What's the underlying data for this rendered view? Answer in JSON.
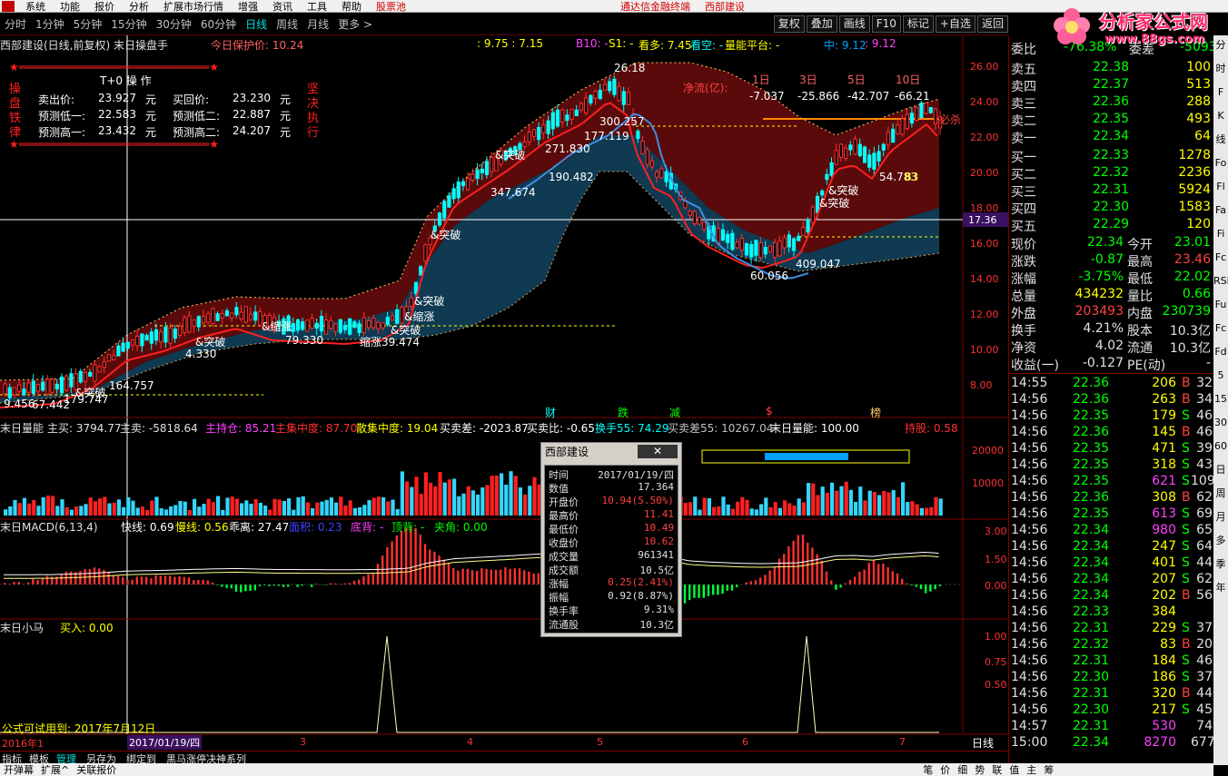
{
  "menubar": {
    "items": [
      "系统",
      "功能",
      "报价",
      "分析",
      "扩展市场行情",
      "资讯",
      "工具",
      "帮助"
    ],
    "extra_items": [
      "增强"
    ],
    "stock_link": "股票池",
    "window_title": "通达信金融终端",
    "stock_title": "西部建设"
  },
  "periodbar": {
    "periods": [
      "分时",
      "1分钟",
      "5分钟",
      "15分钟",
      "30分钟",
      "60分钟",
      "日线",
      "周线",
      "月线",
      "更多 >"
    ],
    "active": "日线",
    "tools": [
      "复权",
      "叠加",
      "画线",
      "F10",
      "标记",
      "+自选",
      "返回"
    ]
  },
  "logo": {
    "line1": "分析家公式网",
    "line2": "www.88gs.com"
  },
  "main_chart": {
    "header_title": "西部建设(日线,前复权) 末日操盘手",
    "protect_price": "今日保护价: 10.24",
    "range_text": ": 9.75 : 7.15",
    "b10": "B10: -",
    "s1": "S1: -",
    "look_up": "看多: 7.45",
    "look_empty": "看空: -",
    "energy": "量能平台: -",
    "mid": "中: 9.12",
    "mid2": ": 9.12",
    "y_ticks": [
      "26.00",
      "24.00",
      "22.00",
      "20.00",
      "18.00",
      "16.00",
      "14.00",
      "12.00",
      "10.00",
      "8.00"
    ],
    "cursor_price": "17.36",
    "t0_title": "T+0 操 作",
    "t0_side_left": [
      "操",
      "盘",
      "铁",
      "律"
    ],
    "t0_side_right": [
      "坚",
      "决",
      "执",
      "行"
    ],
    "t0_rows": [
      {
        "l1": "卖出价:",
        "v1": "23.927",
        "u1": "元",
        "l2": "买回价:",
        "v2": "23.230",
        "u2": "元"
      },
      {
        "l1": "预测低一:",
        "v1": "22.583",
        "u1": "元",
        "l2": "预测低二:",
        "v2": "22.887",
        "u2": "元"
      },
      {
        "l1": "预测高一:",
        "v1": "23.432",
        "u1": "元",
        "l2": "预测高二:",
        "v2": "24.207",
        "u2": "元"
      }
    ],
    "flow_title": "净流(亿):",
    "flow_headers": [
      "1日",
      "3日",
      "5日",
      "10日"
    ],
    "flow_values": [
      "-7.037",
      "-25.866",
      "-42.707",
      "-66.21"
    ],
    "must_kill": "必杀",
    "annotations": [
      "&突破",
      "&突破",
      "&突破",
      "&突破",
      "&突破",
      "&突破",
      "&突破",
      "&突破",
      "&缩涨",
      "缩涨",
      "&缩涨"
    ],
    "labels_num": [
      "26.18",
      "300.257",
      "271.830",
      "177.119",
      "190.482",
      "347.674",
      "164.757",
      "179.747",
      "67.442",
      "9.456",
      "4.330",
      "79.330",
      "39.474",
      "60.056",
      "409.047",
      "54.783",
      "83"
    ],
    "bottom_markers": [
      "财",
      "跌",
      "减",
      "$",
      "榜"
    ]
  },
  "volume_panel": {
    "title": "末日量能",
    "main_buy": "主买: 3794.77",
    "main_sell": "主卖: -5818.64",
    "main_hold": "主持仓: 85.21",
    "main_conc": "主集中度: 87.70",
    "retail_conc": "散集中度: 19.04",
    "diff": "买卖差: -2023.87",
    "ratio": "买卖比: -0.65",
    "turnover": "换手55: 74.29",
    "diff55": "买卖差55: 10267.04",
    "energy": "末日量能: 100.00",
    "hold": "持股: 0.58",
    "y_ticks": [
      "20000",
      "10000"
    ]
  },
  "macd_panel": {
    "title": "末日MACD(6,13,4)",
    "fast": "快线: 0.69",
    "slow": "慢线: 0.56",
    "dev": "乖离: 27.47",
    "area": "面积: 0.23",
    "bottom": "底背: -",
    "top": "顶背: -",
    "angle": "夹角: 0.00",
    "y_ticks": [
      "3.00",
      "1.50",
      "0.00"
    ]
  },
  "horse_panel": {
    "title": "末日小马",
    "buy": "买入: 0.00",
    "trial": "公式可试用到: 2017年7月12日",
    "y_ticks": [
      "1.00",
      "0.75",
      "0.50"
    ]
  },
  "x_axis": {
    "labels": [
      "2016年1",
      "2017/01/19/四",
      "3",
      "4",
      "5",
      "6",
      "7"
    ],
    "period": "日线"
  },
  "popup": {
    "title": "西部建设",
    "close": "✕",
    "rows": [
      {
        "label": "时间",
        "value": "2017/01/19/四",
        "red": false
      },
      {
        "label": "数值",
        "value": "17.364",
        "red": false
      },
      {
        "label": "开盘价",
        "value": "10.94(5.50%)",
        "red": true
      },
      {
        "label": "最高价",
        "value": "11.41",
        "red": true
      },
      {
        "label": "最低价",
        "value": "10.49",
        "red": true
      },
      {
        "label": "收盘价",
        "value": "10.62",
        "red": true
      },
      {
        "label": "成交量",
        "value": "961341",
        "red": false
      },
      {
        "label": "成交额",
        "value": "10.5亿",
        "red": false
      },
      {
        "label": "涨幅",
        "value": "0.25(2.41%)",
        "red": true
      },
      {
        "label": "振幅",
        "value": "0.92(8.87%)",
        "red": false
      },
      {
        "label": "换手率",
        "value": "9.31%",
        "red": false
      },
      {
        "label": "流通股",
        "value": "10.3亿",
        "red": false
      }
    ]
  },
  "quote": {
    "header": "委比",
    "header_val": "-76.38%",
    "header_label2": "委差",
    "header_val2": "-5093",
    "sell": [
      {
        "label": "卖五",
        "price": "22.38",
        "vol": "100"
      },
      {
        "label": "卖四",
        "price": "22.37",
        "vol": "513"
      },
      {
        "label": "卖三",
        "price": "22.36",
        "vol": "288"
      },
      {
        "label": "卖二",
        "price": "22.35",
        "vol": "493"
      },
      {
        "label": "卖一",
        "price": "22.34",
        "vol": "64"
      }
    ],
    "buy": [
      {
        "label": "买一",
        "price": "22.33",
        "vol": "1278"
      },
      {
        "label": "买二",
        "price": "22.32",
        "vol": "2236"
      },
      {
        "label": "买三",
        "price": "22.31",
        "vol": "5924"
      },
      {
        "label": "买四",
        "price": "22.30",
        "vol": "1583"
      },
      {
        "label": "买五",
        "price": "22.29",
        "vol": "120"
      }
    ],
    "stats": [
      {
        "l1": "现价",
        "v1": "22.34",
        "c1": "#00ff00",
        "l2": "今开",
        "v2": "23.01",
        "c2": "#00ff00"
      },
      {
        "l1": "涨跌",
        "v1": "-0.87",
        "c1": "#00ff00",
        "l2": "最高",
        "v2": "23.46",
        "c2": "#ff4040"
      },
      {
        "l1": "涨幅",
        "v1": "-3.75%",
        "c1": "#00ff00",
        "l2": "最低",
        "v2": "22.02",
        "c2": "#00ff00"
      },
      {
        "l1": "总量",
        "v1": "434232",
        "c1": "#ffff00",
        "l2": "量比",
        "v2": "0.66",
        "c2": "#00ff00"
      },
      {
        "l1": "外盘",
        "v1": "203493",
        "c1": "#ff4040",
        "l2": "内盘",
        "v2": "230739",
        "c2": "#00ff00"
      },
      {
        "l1": "换手",
        "v1": "4.21%",
        "c1": "#e0e0e0",
        "l2": "股本",
        "v2": "10.3亿",
        "c2": "#e0e0e0"
      },
      {
        "l1": "净资",
        "v1": "4.02",
        "c1": "#e0e0e0",
        "l2": "流通",
        "v2": "10.3亿",
        "c2": "#e0e0e0"
      },
      {
        "l1": "收益(一)",
        "v1": "-0.127",
        "c1": "#e0e0e0",
        "l2": "PE(动)",
        "v2": "-",
        "c2": "#e0e0e0"
      }
    ],
    "ticks": [
      {
        "t": "14:55",
        "p": "22.36",
        "v": "206",
        "s": "B",
        "n": "32",
        "vc": "#ffff00"
      },
      {
        "t": "14:56",
        "p": "22.36",
        "v": "263",
        "s": "B",
        "n": "34",
        "vc": "#ffff00"
      },
      {
        "t": "14:56",
        "p": "22.35",
        "v": "179",
        "s": "S",
        "n": "46",
        "vc": "#ffff00"
      },
      {
        "t": "14:56",
        "p": "22.36",
        "v": "145",
        "s": "B",
        "n": "46",
        "vc": "#ffff00"
      },
      {
        "t": "14:56",
        "p": "22.35",
        "v": "471",
        "s": "S",
        "n": "39",
        "vc": "#ffff00"
      },
      {
        "t": "14:56",
        "p": "22.35",
        "v": "318",
        "s": "S",
        "n": "43",
        "vc": "#ffff00"
      },
      {
        "t": "14:56",
        "p": "22.35",
        "v": "621",
        "s": "S",
        "n": "109",
        "vc": "#ff40ff"
      },
      {
        "t": "14:56",
        "p": "22.36",
        "v": "308",
        "s": "B",
        "n": "62",
        "vc": "#ffff00"
      },
      {
        "t": "14:56",
        "p": "22.35",
        "v": "613",
        "s": "S",
        "n": "69",
        "vc": "#ff40ff"
      },
      {
        "t": "14:56",
        "p": "22.34",
        "v": "980",
        "s": "S",
        "n": "65",
        "vc": "#ff40ff"
      },
      {
        "t": "14:56",
        "p": "22.34",
        "v": "247",
        "s": "S",
        "n": "64",
        "vc": "#ffff00"
      },
      {
        "t": "14:56",
        "p": "22.34",
        "v": "401",
        "s": "S",
        "n": "44",
        "vc": "#ffff00"
      },
      {
        "t": "14:56",
        "p": "22.34",
        "v": "207",
        "s": "S",
        "n": "62",
        "vc": "#ffff00"
      },
      {
        "t": "14:56",
        "p": "22.34",
        "v": "202",
        "s": "B",
        "n": "56",
        "vc": "#ffff00"
      },
      {
        "t": "14:56",
        "p": "22.33",
        "v": "384",
        "s": "",
        "n": "",
        "vc": "#ffff00"
      },
      {
        "t": "14:56",
        "p": "22.31",
        "v": "229",
        "s": "S",
        "n": "37",
        "vc": "#ffff00"
      },
      {
        "t": "14:56",
        "p": "22.32",
        "v": "83",
        "s": "B",
        "n": "20",
        "vc": "#ffff00"
      },
      {
        "t": "14:56",
        "p": "22.31",
        "v": "184",
        "s": "S",
        "n": "46",
        "vc": "#ffff00"
      },
      {
        "t": "14:56",
        "p": "22.30",
        "v": "186",
        "s": "S",
        "n": "37",
        "vc": "#ffff00"
      },
      {
        "t": "14:56",
        "p": "22.31",
        "v": "320",
        "s": "B",
        "n": "44",
        "vc": "#ffff00"
      },
      {
        "t": "14:56",
        "p": "22.30",
        "v": "217",
        "s": "S",
        "n": "45",
        "vc": "#ffff00"
      },
      {
        "t": "14:57",
        "p": "22.31",
        "v": "530",
        "s": "",
        "n": "74",
        "vc": "#ff40ff"
      },
      {
        "t": "15:00",
        "p": "22.34",
        "v": "8270",
        "s": "",
        "n": "677",
        "vc": "#ff40ff"
      }
    ]
  },
  "right_strip": [
    "分",
    "时",
    "F",
    "K",
    "线",
    "Fo",
    "Fl",
    "Fa",
    "Fi",
    "Fc",
    "RSI",
    "Fu",
    "Fc",
    "Fd",
    "5",
    "15",
    "30",
    "60",
    "日",
    "周",
    "月",
    "多",
    "季",
    "年"
  ],
  "bottombar": {
    "items": [
      "指标",
      "模板",
      "管理",
      "另存为",
      "绑定到",
      "黑马涨停决神系列"
    ],
    "active": "管理",
    "status_left": [
      "开弹幕",
      "扩展^",
      "关联报价"
    ],
    "status_right": [
      "笔",
      "价",
      "细",
      "势",
      "联",
      "值",
      "主",
      "筹"
    ]
  },
  "colors": {
    "up": "#ff3030",
    "down": "#00ffff",
    "ma_red": "#ff2020",
    "ma_blue": "#3f8fe0",
    "band_dark": "#5a0a0a",
    "band_teal": "#0f3a52",
    "accent_yellow": "#ffff00"
  }
}
